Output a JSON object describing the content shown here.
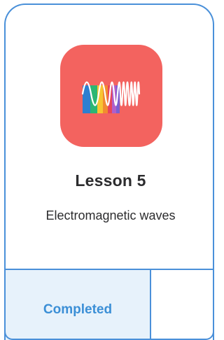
{
  "lesson_card": {
    "thumbnail_icon": "electromagnetic-spectrum-wave-icon",
    "thumbnail_color": "#f3635f",
    "title": "Lesson 5",
    "subtitle": "Electromagnetic waves",
    "status": "Completed",
    "accent_color": "#4a90d9",
    "status_bg_color": "#e7f2fb"
  }
}
